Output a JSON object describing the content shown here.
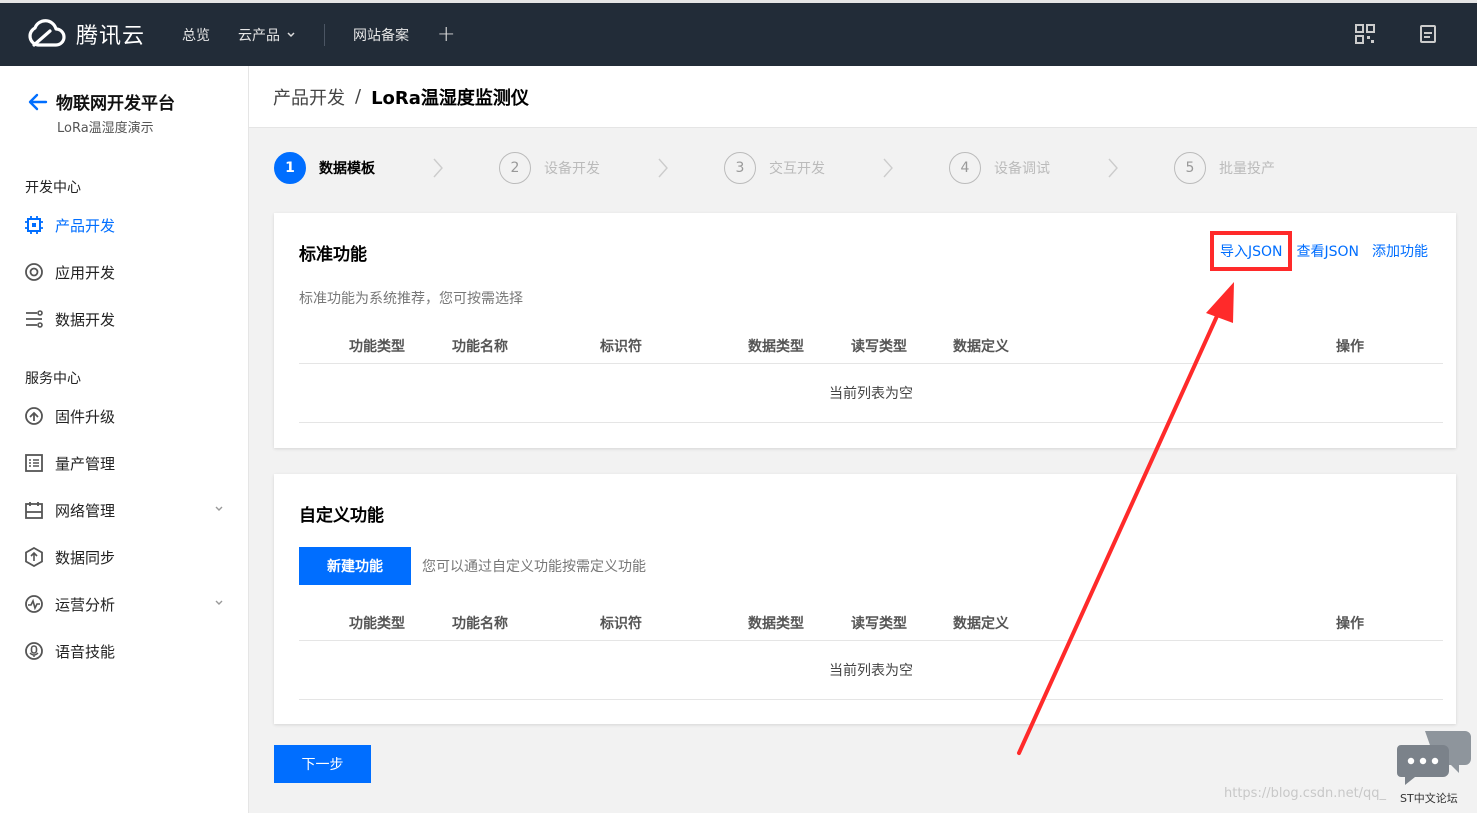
{
  "topbar": {
    "brand": "腾讯云",
    "nav": [
      {
        "label": "总览"
      },
      {
        "label": "云产品"
      },
      {
        "label": "网站备案"
      }
    ],
    "plus": "+"
  },
  "sidebar": {
    "back_title": "物联网开发平台",
    "subtitle": "LoRa温湿度演示",
    "section_dev": "开发中心",
    "section_service": "服务中心",
    "dev_items": [
      {
        "label": "产品开发",
        "icon": "chip-icon",
        "active": true
      },
      {
        "label": "应用开发",
        "icon": "app-icon"
      },
      {
        "label": "数据开发",
        "icon": "data-flow-icon"
      }
    ],
    "service_items": [
      {
        "label": "固件升级",
        "icon": "firmware-icon"
      },
      {
        "label": "量产管理",
        "icon": "list-icon"
      },
      {
        "label": "网络管理",
        "icon": "network-icon",
        "expandable": true
      },
      {
        "label": "数据同步",
        "icon": "sync-icon"
      },
      {
        "label": "运营分析",
        "icon": "analytics-icon",
        "expandable": true
      },
      {
        "label": "语音技能",
        "icon": "voice-icon"
      }
    ]
  },
  "breadcrumb": {
    "parent": "产品开发",
    "separator": "/",
    "current": "LoRa温湿度监测仪"
  },
  "steps": [
    {
      "num": "1",
      "label": "数据模板",
      "active": true
    },
    {
      "num": "2",
      "label": "设备开发"
    },
    {
      "num": "3",
      "label": "交互开发"
    },
    {
      "num": "4",
      "label": "设备调试"
    },
    {
      "num": "5",
      "label": "批量投产"
    }
  ],
  "standard": {
    "title": "标准功能",
    "desc": "标准功能为系统推荐，您可按需选择",
    "import_json": "导入JSON",
    "view_json": "查看JSON",
    "add_feature": "添加功能",
    "empty": "当前列表为空"
  },
  "custom": {
    "title": "自定义功能",
    "new_button": "新建功能",
    "hint": "您可以通过自定义功能按需定义功能",
    "empty": "当前列表为空"
  },
  "table_headers": [
    "功能类型",
    "功能名称",
    "标识符",
    "数据类型",
    "读写类型",
    "数据定义",
    "操作"
  ],
  "next_button": "下一步",
  "colors": {
    "brand": "#006eff",
    "topbar": "#222c38",
    "annotation": "#ff2a2a"
  },
  "watermark": "https://blog.csdn.net/qq_",
  "forum_mark": "ST中文论坛"
}
